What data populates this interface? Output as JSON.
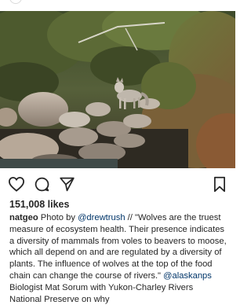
{
  "post": {
    "likes": "151,008 likes",
    "caption": {
      "username": "natgeo",
      "segments": [
        {
          "type": "text",
          "value": " Photo by "
        },
        {
          "type": "mention",
          "value": "@drewtrush"
        },
        {
          "type": "text",
          "value": " // \"Wolves are the truest measure of ecosystem health.  Their presence indicates a diversity of mammals from voles to beavers to moose, which all depend on and are regulated by a diversity of plants.  The influence of wolves at the top of the food chain can change the course of rivers.\" "
        },
        {
          "type": "mention",
          "value": "@alaskanps"
        },
        {
          "type": "text",
          "value": " Biologist Mat Sorum with Yukon-Charley Rivers National Preserve on why"
        }
      ]
    }
  },
  "icons": {
    "like": "heart-outline-icon",
    "comment": "comment-bubble-icon",
    "share": "paper-plane-icon",
    "save": "bookmark-outline-icon"
  },
  "colors": {
    "text": "#262626",
    "mention": "#003569",
    "background": "#ffffff"
  }
}
